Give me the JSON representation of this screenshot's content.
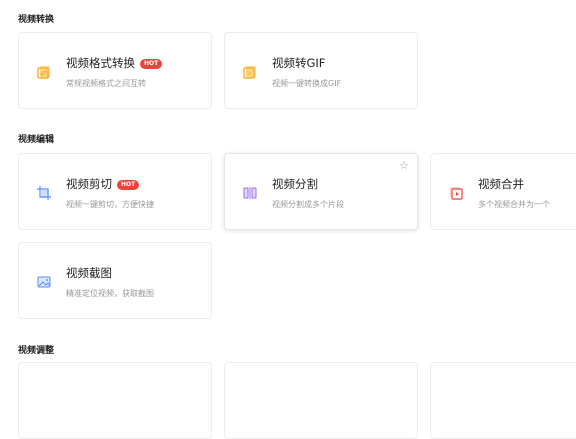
{
  "sections": [
    {
      "title": "视频转换"
    },
    {
      "title": "视频编辑"
    },
    {
      "title": "视频调整"
    }
  ],
  "cards": {
    "format_convert": {
      "title": "视频格式转换",
      "desc": "常规视频格式之间互转",
      "badge": "HOT",
      "icon": "format-convert-icon"
    },
    "to_gif": {
      "title": "视频转GIF",
      "desc": "视频一键转换成GIF",
      "icon": "gif-convert-icon"
    },
    "cut": {
      "title": "视频剪切",
      "desc": "视频一键剪切，方便快捷",
      "badge": "HOT",
      "icon": "crop-icon"
    },
    "split": {
      "title": "视频分割",
      "desc": "视频分割成多个片段",
      "icon": "split-icon",
      "star": "☆"
    },
    "merge": {
      "title": "视频合并",
      "desc": "多个视频合并为一个",
      "icon": "merge-icon"
    },
    "screenshot": {
      "title": "视频截图",
      "desc": "精准定位视频，获取截图",
      "icon": "screenshot-icon"
    }
  },
  "colors": {
    "accent": "#f0413a",
    "orange": "#f5a623",
    "blue": "#5b8ff9",
    "purple": "#9b6cf0"
  }
}
